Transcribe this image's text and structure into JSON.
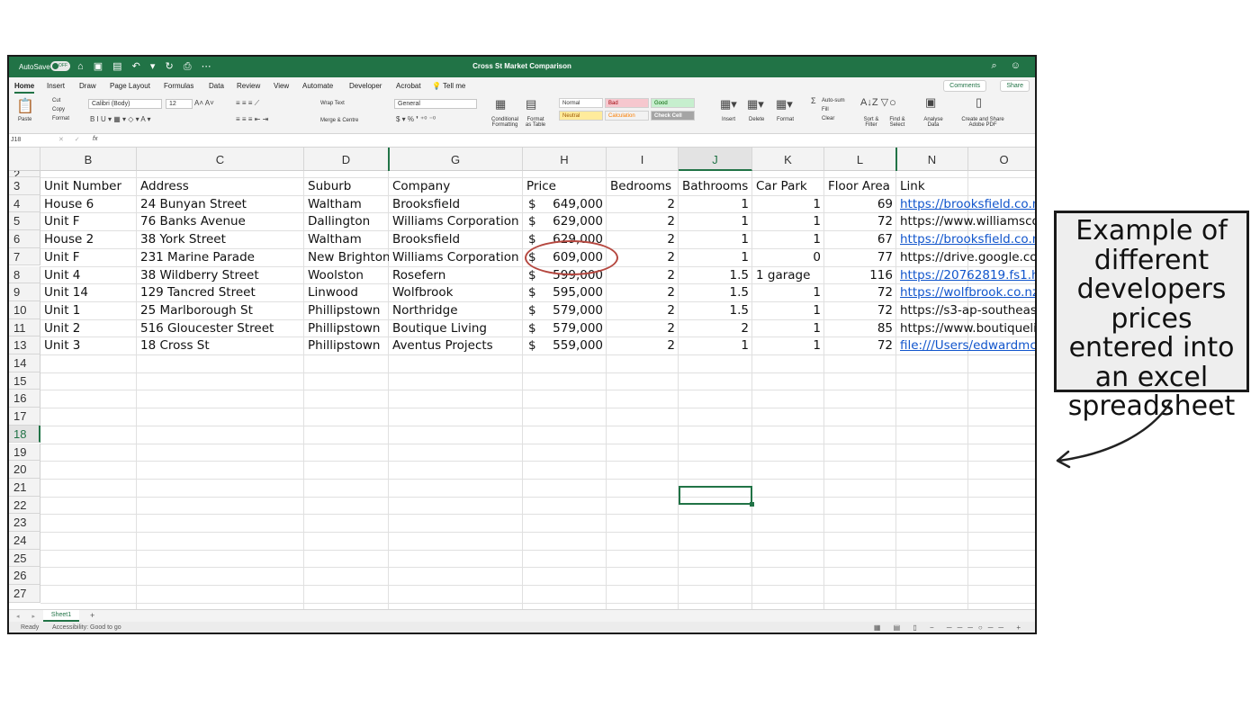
{
  "window": {
    "title": "Cross St Market Comparison",
    "autosave_label": "AutoSave",
    "autosave_state": "OFF"
  },
  "menu": {
    "tabs": [
      "Home",
      "Insert",
      "Draw",
      "Page Layout",
      "Formulas",
      "Data",
      "Review",
      "View",
      "Automate",
      "Developer",
      "Acrobat"
    ],
    "active": "Home",
    "tell_me": "Tell me",
    "comments": "Comments",
    "share": "Share"
  },
  "ribbon": {
    "paste": "Paste",
    "cut": "Cut",
    "copy": "Copy",
    "format": "Format",
    "font_name": "Calibri (Body)",
    "font_size": "12",
    "wrap_text": "Wrap Text",
    "merge_centre": "Merge & Centre",
    "number_format": "General",
    "conditional_formatting": "Conditional Formatting",
    "format_as_table": "Format as Table",
    "styles": {
      "normal": "Normal",
      "bad": "Bad",
      "good": "Good",
      "neutral": "Neutral",
      "calculation": "Calculation",
      "check_cell": "Check Cell"
    },
    "insert": "Insert",
    "delete": "Delete",
    "format_cells": "Format",
    "autosum": "Auto-sum",
    "fill": "Fill",
    "clear": "Clear",
    "sort_filter": "Sort & Filter",
    "find_select": "Find & Select",
    "analyse_data": "Analyse Data",
    "create_share_pdf": "Create and Share Adobe PDF"
  },
  "formula_bar": {
    "name_box": "J18",
    "fx": "fx",
    "content": ""
  },
  "grid": {
    "columns": [
      "B",
      "C",
      "D",
      "G",
      "H",
      "I",
      "J",
      "K",
      "L",
      "N",
      "O"
    ],
    "selected_column": "J",
    "row_numbers": [
      "2",
      "3",
      "4",
      "5",
      "6",
      "7",
      "8",
      "9",
      "10",
      "11",
      "13",
      "14",
      "15",
      "16",
      "17",
      "18",
      "19",
      "20",
      "21",
      "22",
      "23",
      "24",
      "25",
      "26",
      "27"
    ],
    "selected_row": "18",
    "headers": [
      "Unit Number",
      "Address",
      "Suburb",
      "Company",
      "Price",
      "Bedrooms",
      "Bathrooms",
      "Car Park",
      "Floor Area",
      "Link"
    ],
    "rows": [
      {
        "unit": "House 6",
        "address": "24 Bunyan Street",
        "suburb": "Waltham",
        "company": "Brooksfield",
        "currency": "$",
        "price": "649,000",
        "bedrooms": "2",
        "bathrooms": "1",
        "car_park": "1",
        "floor_area": "69",
        "link": "https://brooksfield.co.nz/",
        "link_style": "link"
      },
      {
        "unit": "Unit F",
        "address": "76 Banks Avenue",
        "suburb": "Dallington",
        "company": "Williams Corporation",
        "currency": "$",
        "price": "629,000",
        "bedrooms": "2",
        "bathrooms": "1",
        "car_park": "1",
        "floor_area": "72",
        "link": "https://www.williamscor",
        "link_style": "plain"
      },
      {
        "unit": "House 2",
        "address": "38 York Street",
        "suburb": "Waltham",
        "company": "Brooksfield",
        "currency": "$",
        "price": "629,000",
        "bedrooms": "2",
        "bathrooms": "1",
        "car_park": "1",
        "floor_area": "67",
        "link": "https://brooksfield.co.nz/",
        "link_style": "link"
      },
      {
        "unit": "Unit F",
        "address": "231 Marine Parade",
        "suburb": "New Brighton",
        "company": "Williams Corporation",
        "currency": "$",
        "price": "609,000",
        "bedrooms": "2",
        "bathrooms": "1",
        "car_park": "0",
        "floor_area": "77",
        "link": "https://drive.google.com/",
        "link_style": "plain"
      },
      {
        "unit": "Unit 4",
        "address": "38 Wildberry Street",
        "suburb": "Woolston",
        "company": "Rosefern",
        "currency": "$",
        "price": "599,000",
        "bedrooms": "2",
        "bathrooms": "1.5",
        "car_park": "1 garage",
        "car_park_align": "left",
        "floor_area": "116",
        "link": "https://20762819.fs1.hub",
        "link_style": "link"
      },
      {
        "unit": "Unit 14",
        "address": "129 Tancred Street",
        "suburb": "Linwood",
        "company": "Wolfbrook",
        "currency": "$",
        "price": "595,000",
        "bedrooms": "2",
        "bathrooms": "1.5",
        "car_park": "1",
        "floor_area": "72",
        "link": "https://wolfbrook.co.nz/",
        "link_style": "link"
      },
      {
        "unit": "Unit 1",
        "address": "25 Marlborough St",
        "suburb": "Phillipstown",
        "company": "Northridge",
        "currency": "$",
        "price": "579,000",
        "bedrooms": "2",
        "bathrooms": "1.5",
        "car_park": "1",
        "floor_area": "72",
        "link": "https://s3-ap-southeast-2",
        "link_style": "plain"
      },
      {
        "unit": "Unit 2",
        "address": "516 Gloucester Street",
        "suburb": "Phillipstown",
        "company": "Boutique Living",
        "currency": "$",
        "price": "579,000",
        "bedrooms": "2",
        "bathrooms": "2",
        "car_park": "1",
        "floor_area": "85",
        "link": "https://www.boutiquelivi",
        "link_style": "plain"
      },
      {
        "unit": "Unit 3",
        "address": "18 Cross St",
        "suburb": "Phillipstown",
        "company": "Aventus Projects",
        "currency": "$",
        "price": "559,000",
        "bedrooms": "2",
        "bathrooms": "1",
        "car_park": "1",
        "floor_area": "72",
        "link": "file:///Users/edwardmck",
        "link_style": "link"
      }
    ]
  },
  "sheet_tabs": {
    "tabs": [
      "Sheet1"
    ],
    "add": "+"
  },
  "status_bar": {
    "ready": "Ready",
    "accessibility": "Accessibility: Good to go"
  },
  "annotation": {
    "text": "Example of different developers prices entered into an excel spreadsheet"
  }
}
